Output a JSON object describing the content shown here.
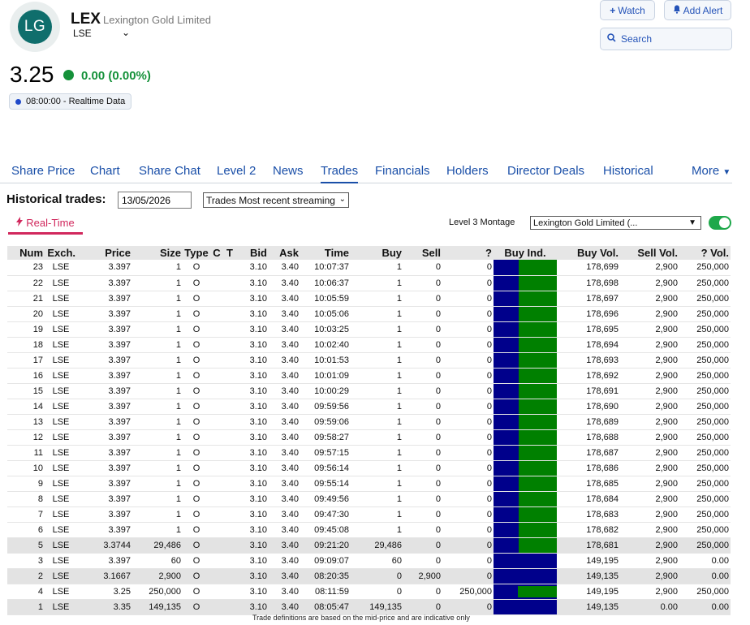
{
  "header": {
    "logo_text": "LG",
    "ticker": "LEX",
    "company": "Lexington Gold Limited",
    "exchange": "LSE",
    "watch_label": "Watch",
    "alert_label": "Add Alert",
    "search_placeholder": "Search",
    "price": "3.25",
    "change": "0.00 (0.00%)",
    "realtime": "08:00:00 - Realtime Data"
  },
  "tabs": [
    "Share Price",
    "Chart",
    "Share Chat",
    "Level 2",
    "News",
    "Trades",
    "Financials",
    "Holders",
    "Director Deals",
    "Historical",
    "More"
  ],
  "active_tab": "Trades",
  "controls": {
    "historical_label": "Historical trades:",
    "date_value": "13/05/2026",
    "trades_select": "Trades Most recent streaming",
    "realtime_tab": "Real-Time",
    "level3_label": "Level 3 Montage",
    "level3_select": "Lexington Gold Limited (..."
  },
  "colors": {
    "buy_indicator": "#008000",
    "sell_indicator": "#00008b",
    "accent": "#1a4fa8",
    "realtime": "#d1285d"
  },
  "table": {
    "columns": [
      "Num",
      "Exch.",
      "Price",
      "Size",
      "Type",
      "C",
      "T",
      "Bid",
      "Ask",
      "Time",
      "Buy",
      "Sell",
      "?",
      "Buy Ind.",
      "Buy Vol.",
      "Sell Vol.",
      "? Vol."
    ],
    "rows": [
      {
        "num": "23",
        "exch": "LSE",
        "price": "3.397",
        "size": "1",
        "type": "O",
        "bid": "3.10",
        "ask": "3.40",
        "time": "10:07:37",
        "buy": "1",
        "sell": "0",
        "q": "0",
        "buy_ind": 0.6,
        "buy_vol": "178,699",
        "sell_vol": "2,900",
        "q_vol": "250,000"
      },
      {
        "num": "22",
        "exch": "LSE",
        "price": "3.397",
        "size": "1",
        "type": "O",
        "bid": "3.10",
        "ask": "3.40",
        "time": "10:06:37",
        "buy": "1",
        "sell": "0",
        "q": "0",
        "buy_ind": 0.6,
        "buy_vol": "178,698",
        "sell_vol": "2,900",
        "q_vol": "250,000"
      },
      {
        "num": "21",
        "exch": "LSE",
        "price": "3.397",
        "size": "1",
        "type": "O",
        "bid": "3.10",
        "ask": "3.40",
        "time": "10:05:59",
        "buy": "1",
        "sell": "0",
        "q": "0",
        "buy_ind": 0.6,
        "buy_vol": "178,697",
        "sell_vol": "2,900",
        "q_vol": "250,000"
      },
      {
        "num": "20",
        "exch": "LSE",
        "price": "3.397",
        "size": "1",
        "type": "O",
        "bid": "3.10",
        "ask": "3.40",
        "time": "10:05:06",
        "buy": "1",
        "sell": "0",
        "q": "0",
        "buy_ind": 0.6,
        "buy_vol": "178,696",
        "sell_vol": "2,900",
        "q_vol": "250,000"
      },
      {
        "num": "19",
        "exch": "LSE",
        "price": "3.397",
        "size": "1",
        "type": "O",
        "bid": "3.10",
        "ask": "3.40",
        "time": "10:03:25",
        "buy": "1",
        "sell": "0",
        "q": "0",
        "buy_ind": 0.6,
        "buy_vol": "178,695",
        "sell_vol": "2,900",
        "q_vol": "250,000"
      },
      {
        "num": "18",
        "exch": "LSE",
        "price": "3.397",
        "size": "1",
        "type": "O",
        "bid": "3.10",
        "ask": "3.40",
        "time": "10:02:40",
        "buy": "1",
        "sell": "0",
        "q": "0",
        "buy_ind": 0.6,
        "buy_vol": "178,694",
        "sell_vol": "2,900",
        "q_vol": "250,000"
      },
      {
        "num": "17",
        "exch": "LSE",
        "price": "3.397",
        "size": "1",
        "type": "O",
        "bid": "3.10",
        "ask": "3.40",
        "time": "10:01:53",
        "buy": "1",
        "sell": "0",
        "q": "0",
        "buy_ind": 0.6,
        "buy_vol": "178,693",
        "sell_vol": "2,900",
        "q_vol": "250,000"
      },
      {
        "num": "16",
        "exch": "LSE",
        "price": "3.397",
        "size": "1",
        "type": "O",
        "bid": "3.10",
        "ask": "3.40",
        "time": "10:01:09",
        "buy": "1",
        "sell": "0",
        "q": "0",
        "buy_ind": 0.6,
        "buy_vol": "178,692",
        "sell_vol": "2,900",
        "q_vol": "250,000"
      },
      {
        "num": "15",
        "exch": "LSE",
        "price": "3.397",
        "size": "1",
        "type": "O",
        "bid": "3.10",
        "ask": "3.40",
        "time": "10:00:29",
        "buy": "1",
        "sell": "0",
        "q": "0",
        "buy_ind": 0.6,
        "buy_vol": "178,691",
        "sell_vol": "2,900",
        "q_vol": "250,000"
      },
      {
        "num": "14",
        "exch": "LSE",
        "price": "3.397",
        "size": "1",
        "type": "O",
        "bid": "3.10",
        "ask": "3.40",
        "time": "09:59:56",
        "buy": "1",
        "sell": "0",
        "q": "0",
        "buy_ind": 0.6,
        "buy_vol": "178,690",
        "sell_vol": "2,900",
        "q_vol": "250,000"
      },
      {
        "num": "13",
        "exch": "LSE",
        "price": "3.397",
        "size": "1",
        "type": "O",
        "bid": "3.10",
        "ask": "3.40",
        "time": "09:59:06",
        "buy": "1",
        "sell": "0",
        "q": "0",
        "buy_ind": 0.6,
        "buy_vol": "178,689",
        "sell_vol": "2,900",
        "q_vol": "250,000"
      },
      {
        "num": "12",
        "exch": "LSE",
        "price": "3.397",
        "size": "1",
        "type": "O",
        "bid": "3.10",
        "ask": "3.40",
        "time": "09:58:27",
        "buy": "1",
        "sell": "0",
        "q": "0",
        "buy_ind": 0.6,
        "buy_vol": "178,688",
        "sell_vol": "2,900",
        "q_vol": "250,000"
      },
      {
        "num": "11",
        "exch": "LSE",
        "price": "3.397",
        "size": "1",
        "type": "O",
        "bid": "3.10",
        "ask": "3.40",
        "time": "09:57:15",
        "buy": "1",
        "sell": "0",
        "q": "0",
        "buy_ind": 0.6,
        "buy_vol": "178,687",
        "sell_vol": "2,900",
        "q_vol": "250,000"
      },
      {
        "num": "10",
        "exch": "LSE",
        "price": "3.397",
        "size": "1",
        "type": "O",
        "bid": "3.10",
        "ask": "3.40",
        "time": "09:56:14",
        "buy": "1",
        "sell": "0",
        "q": "0",
        "buy_ind": 0.6,
        "buy_vol": "178,686",
        "sell_vol": "2,900",
        "q_vol": "250,000"
      },
      {
        "num": "9",
        "exch": "LSE",
        "price": "3.397",
        "size": "1",
        "type": "O",
        "bid": "3.10",
        "ask": "3.40",
        "time": "09:55:14",
        "buy": "1",
        "sell": "0",
        "q": "0",
        "buy_ind": 0.6,
        "buy_vol": "178,685",
        "sell_vol": "2,900",
        "q_vol": "250,000"
      },
      {
        "num": "8",
        "exch": "LSE",
        "price": "3.397",
        "size": "1",
        "type": "O",
        "bid": "3.10",
        "ask": "3.40",
        "time": "09:49:56",
        "buy": "1",
        "sell": "0",
        "q": "0",
        "buy_ind": 0.6,
        "buy_vol": "178,684",
        "sell_vol": "2,900",
        "q_vol": "250,000"
      },
      {
        "num": "7",
        "exch": "LSE",
        "price": "3.397",
        "size": "1",
        "type": "O",
        "bid": "3.10",
        "ask": "3.40",
        "time": "09:47:30",
        "buy": "1",
        "sell": "0",
        "q": "0",
        "buy_ind": 0.6,
        "buy_vol": "178,683",
        "sell_vol": "2,900",
        "q_vol": "250,000"
      },
      {
        "num": "6",
        "exch": "LSE",
        "price": "3.397",
        "size": "1",
        "type": "O",
        "bid": "3.10",
        "ask": "3.40",
        "time": "09:45:08",
        "buy": "1",
        "sell": "0",
        "q": "0",
        "buy_ind": 0.6,
        "buy_vol": "178,682",
        "sell_vol": "2,900",
        "q_vol": "250,000"
      },
      {
        "num": "5",
        "exch": "LSE",
        "price": "3.3744",
        "size": "29,486",
        "type": "O",
        "bid": "3.10",
        "ask": "3.40",
        "time": "09:21:20",
        "buy": "29,486",
        "sell": "0",
        "q": "0",
        "buy_ind": 0.6,
        "buy_vol": "178,681",
        "sell_vol": "2,900",
        "q_vol": "250,000",
        "band": true
      },
      {
        "num": "3",
        "exch": "LSE",
        "price": "3.397",
        "size": "60",
        "type": "O",
        "bid": "3.10",
        "ask": "3.40",
        "time": "09:09:07",
        "buy": "60",
        "sell": "0",
        "q": "0",
        "buy_ind": 0,
        "buy_vol": "149,195",
        "sell_vol": "2,900",
        "q_vol": "0.00"
      },
      {
        "num": "2",
        "exch": "LSE",
        "price": "3.1667",
        "size": "2,900",
        "type": "O",
        "bid": "3.10",
        "ask": "3.40",
        "time": "08:20:35",
        "buy": "0",
        "sell": "2,900",
        "q": "0",
        "buy_ind": 0,
        "buy_vol": "149,135",
        "sell_vol": "2,900",
        "q_vol": "0.00",
        "band": true
      },
      {
        "num": "4",
        "exch": "LSE",
        "price": "3.25",
        "size": "250,000",
        "type": "O",
        "bid": "3.10",
        "ask": "3.40",
        "time": "08:11:59",
        "buy": "0",
        "sell": "0",
        "q": "250,000",
        "buy_ind": 0.6,
        "buy_vol": "149,195",
        "sell_vol": "2,900",
        "q_vol": "250,000",
        "short_bar": true
      },
      {
        "num": "1",
        "exch": "LSE",
        "price": "3.35",
        "size": "149,135",
        "type": "O",
        "bid": "3.10",
        "ask": "3.40",
        "time": "08:05:47",
        "buy": "149,135",
        "sell": "0",
        "q": "0",
        "buy_ind": 0,
        "buy_vol": "149,135",
        "sell_vol": "0.00",
        "q_vol": "0.00",
        "band": true
      }
    ]
  },
  "footer_note": "Trade definitions are based on the mid-price and are indicative only"
}
